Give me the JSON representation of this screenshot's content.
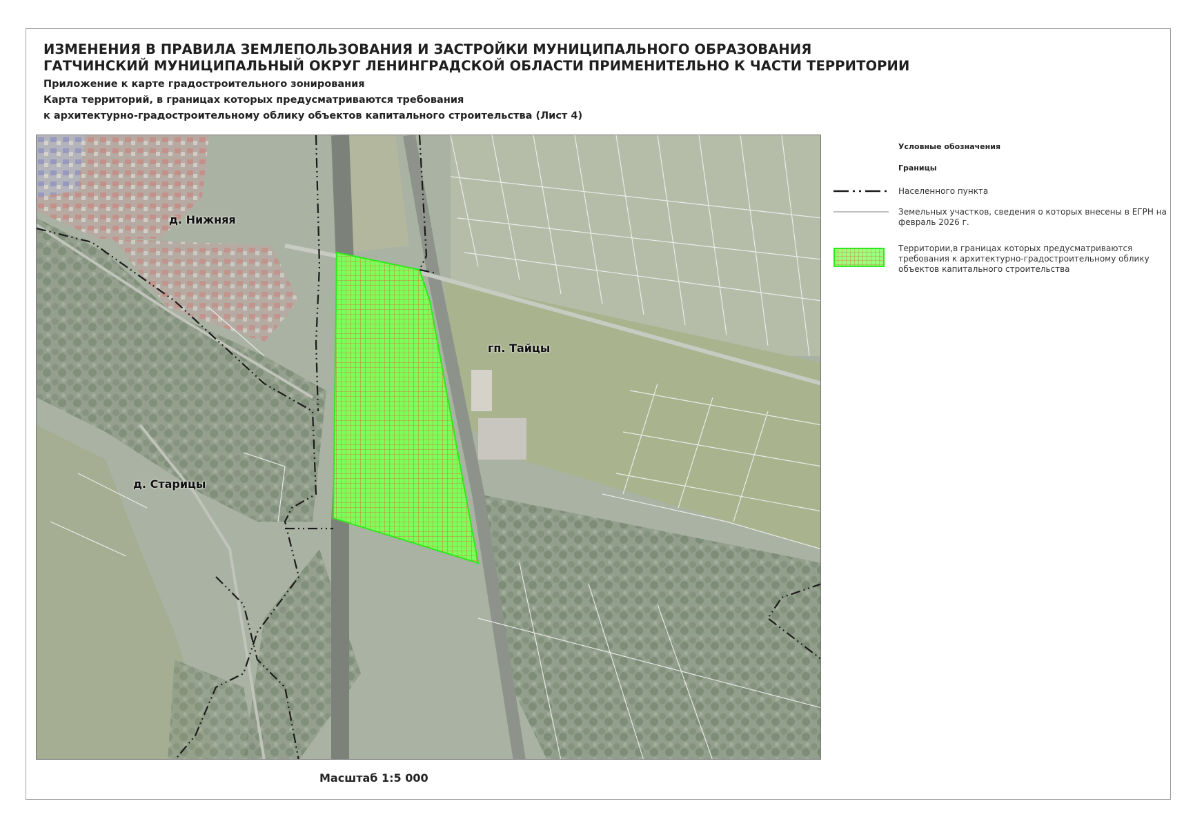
{
  "title": {
    "line1": "ИЗМЕНЕНИЯ В ПРАВИЛА ЗЕМЛЕПОЛЬЗОВАНИЯ И ЗАСТРОЙКИ МУНИЦИПАЛЬНОГО ОБРАЗОВАНИЯ",
    "line2": "ГАТЧИНСКИЙ МУНИЦИПАЛЬНЫЙ ОКРУГ ЛЕНИНГРАДСКОЙ ОБЛАСТИ ПРИМЕНИТЕЛЬНО К ЧАСТИ ТЕРРИТОРИИ"
  },
  "subtitle": {
    "appendix": "Приложение к карте градостроительного зонирования",
    "map_line1": "Карта территорий, в границах которых предусматриваются требования",
    "map_line2": "к архитектурно-градостроительному облику объектов капитального строительства (Лист 4)"
  },
  "map": {
    "places": {
      "nizhnyaya": "д. Нижняя",
      "taitsy": "гп. Тайцы",
      "staritsy": "д. Старицы"
    },
    "colors": {
      "zone_fill": "#7dff5a",
      "zone_hatch": "#e05a3a",
      "zone_border": "#2ee81c",
      "settlement_boundary": "#1a1a1a",
      "parcel_line": "#f2f2f2",
      "imagery_base": "#aab2a3"
    }
  },
  "scale": "Масштаб 1:5 000",
  "legend": {
    "title": "Условные обозначения",
    "section": "Границы",
    "items": [
      {
        "symbol": "dash-dot-line-icon",
        "label": "Населенного пункта"
      },
      {
        "symbol": "thin-line-icon",
        "label": "Земельных участков, сведения о которых внесены в ЕГРН на февраль 2026 г."
      },
      {
        "symbol": "green-hatch-icon",
        "label": "Территории,в границах которых предусматриваются требования к архитектурно-градостроительному облику объектов капитального строительства"
      }
    ]
  }
}
